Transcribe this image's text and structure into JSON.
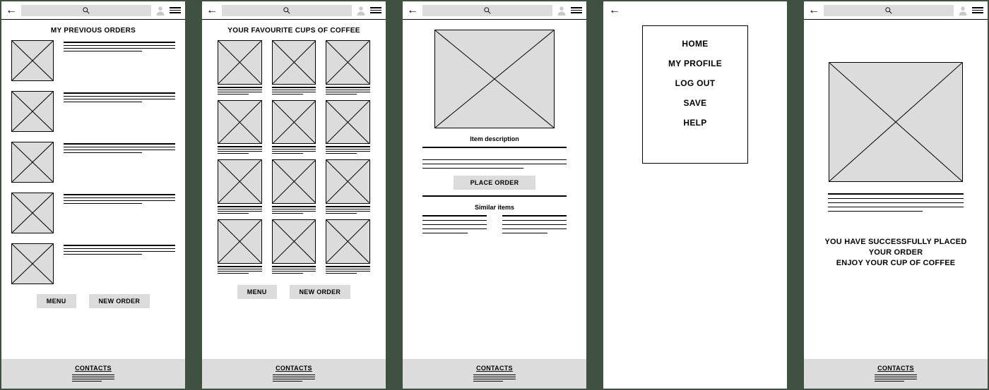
{
  "screen1": {
    "title": "MY PREVIOUS ORDERS",
    "menu_btn": "MENU",
    "new_order_btn": "NEW ORDER",
    "footer": "CONTACTS"
  },
  "screen2": {
    "title": "YOUR FAVOURITE CUPS OF COFFEE",
    "menu_btn": "MENU",
    "new_order_btn": "NEW ORDER",
    "footer": "CONTACTS"
  },
  "screen3": {
    "item_desc_title": "Item description",
    "place_order_btn": "PLACE ORDER",
    "similar_title": "Similar items",
    "footer": "CONTACTS"
  },
  "screen4": {
    "menu": {
      "home": "HOME",
      "profile": "MY PROFILE",
      "logout": "LOG OUT",
      "save": "SAVE",
      "help": "HELP"
    }
  },
  "screen5": {
    "success_line1": "YOU HAVE SUCCESSFULLY PLACED YOUR ORDER",
    "success_line2": "ENJOY YOUR CUP OF COFFEE",
    "footer": "CONTACTS"
  }
}
